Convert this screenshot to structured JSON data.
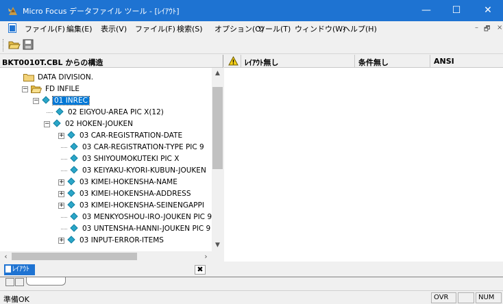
{
  "window": {
    "title": "Micro Focus データファイル ツール - [ﾚｲｱｳﾄ]",
    "minimize_symbol": "—",
    "maximize_symbol": "☐",
    "close_symbol": "✕"
  },
  "menu": {
    "items": [
      {
        "label": "ファイル(F)"
      },
      {
        "label": "編集(E)"
      },
      {
        "label": "表示(V)"
      },
      {
        "label": "ファイル(F)"
      },
      {
        "label": "検索(S)"
      },
      {
        "label": "オプション(O)"
      },
      {
        "label": "ツール(T)"
      },
      {
        "label": "ウィンドウ(W)"
      },
      {
        "label": "ヘルプ(H)"
      }
    ],
    "mdi_min": "–",
    "mdi_restore": "🗗",
    "mdi_close": "×"
  },
  "tree": {
    "header": "BKT0010T.CBL からの構造",
    "nodes": [
      {
        "label": "DATA DIVISION.",
        "icon": "folder-icon"
      },
      {
        "label": "FD INFILE",
        "icon": "open-folder-icon",
        "toggle": "−"
      },
      {
        "label": "01 INREC",
        "icon": "diamond-icon",
        "toggle": "−",
        "selected": true
      },
      {
        "label": "02 EIGYOU-AREA PIC X(12)",
        "icon": "diamond-icon"
      },
      {
        "label": "02 HOKEN-JOUKEN",
        "icon": "diamond-icon",
        "toggle": "−"
      },
      {
        "label": "03 CAR-REGISTRATION-DATE",
        "icon": "diamond-icon",
        "toggle": "+"
      },
      {
        "label": "03 CAR-REGISTRATION-TYPE PIC 9",
        "icon": "diamond-icon"
      },
      {
        "label": "03 SHIYOUMOKUTEKI PIC X",
        "icon": "diamond-icon"
      },
      {
        "label": "03 KEIYAKU-KYORI-KUBUN-JOUKEN",
        "icon": "diamond-icon"
      },
      {
        "label": "03 KIMEI-HOKENSHA-NAME",
        "icon": "diamond-icon",
        "toggle": "+"
      },
      {
        "label": "03 KIMEI-HOKENSHA-ADDRESS",
        "icon": "diamond-icon",
        "toggle": "+"
      },
      {
        "label": "03 KIMEI-HOKENSHA-SEINENGAPPI",
        "icon": "diamond-icon",
        "toggle": "+"
      },
      {
        "label": "03 MENKYOSHOU-IRO-JOUKEN PIC 9",
        "icon": "diamond-icon"
      },
      {
        "label": "03 UNTENSHA-HANNI-JOUKEN PIC 9",
        "icon": "diamond-icon"
      },
      {
        "label": "03 INPUT-ERROR-ITEMS",
        "icon": "diamond-icon",
        "toggle": "+"
      }
    ]
  },
  "layout_header": {
    "col1": "ﾚｲｱｳﾄ無し",
    "col2": "条件無し",
    "col3": "ANSI"
  },
  "doc_window": {
    "tab_label": "ﾚｲｱｳﾄ",
    "close_symbol": "✖",
    "bottom_tab_label": "​"
  },
  "status": {
    "text": "準備OK",
    "ovr": "OVR",
    "num": "NUM"
  },
  "colors": {
    "titlebar": "#1e73d2",
    "selection": "#0078d7",
    "diamond": "#2aa6c8"
  }
}
